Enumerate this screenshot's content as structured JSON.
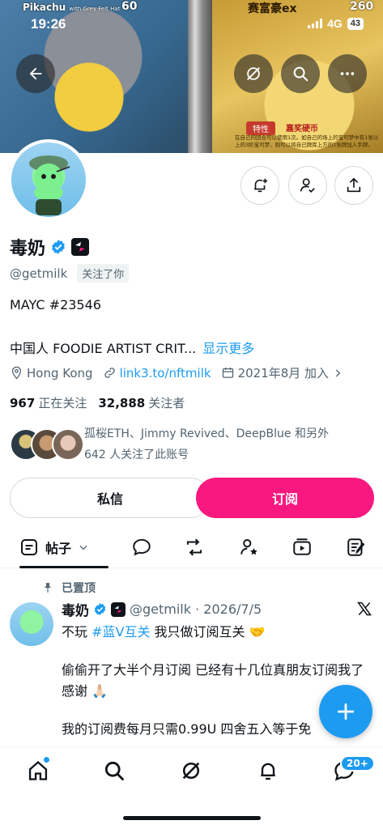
{
  "status": {
    "time": "19:26",
    "network": "4G",
    "battery": "43"
  },
  "banner": {
    "left_card_name": "Pikachu",
    "left_card_subtitle": "with Grey Felt Hat",
    "left_card_hp": "60",
    "right_card_name": "赛富豪ex",
    "right_card_hp": "260",
    "right_card_tag": "特性",
    "right_card_ability": "嘉奖硬币",
    "right_card_text": "在自己的回合可以使用1次。如自己的场上的宝可梦中有1张以上的3阶宝可梦，则可以将自己牌库上方的1张牌加入手牌。"
  },
  "profile": {
    "name": "毒奶",
    "handle": "@getmilk",
    "follows_you": "关注了你",
    "bio_line1": "MAYC #23546",
    "bio_line2": "中国人 FOODIE ARTIST CRIT...",
    "show_more": "显示更多",
    "location": "Hong Kong",
    "link": "link3.to/nftmilk",
    "joined": "2021年8月 加入",
    "following_count": "967",
    "following_label": "正在关注",
    "followers_count": "32,888",
    "followers_label": "关注者",
    "known_followers_line1": "孤桜ETH、Jimmy Revived、DeepBlue 和另外",
    "known_followers_line2": "642 人关注了此账号"
  },
  "actions": {
    "dm": "私信",
    "subscribe": "订阅"
  },
  "tabs": {
    "active": "帖子"
  },
  "post": {
    "pinned": "已置顶",
    "name": "毒奶",
    "handle_date": "@getmilk · 2026/7/5",
    "line1_prefix": "不玩 ",
    "line1_tag": "#蓝V互关",
    "line1_suffix": " 我只做订阅互关 🤝",
    "para2": "偷偷开了大半个月订阅 已经有十几位真朋友订阅我了 感谢 🙏🏻",
    "para3": "我的订阅费每月只需0.99U 四舍五入等于免"
  },
  "nav": {
    "messages_badge": "20+"
  },
  "colors": {
    "accent": "#1d9bf0",
    "subscribe": "#f91880",
    "text": "#0f1419",
    "muted": "#536471"
  }
}
